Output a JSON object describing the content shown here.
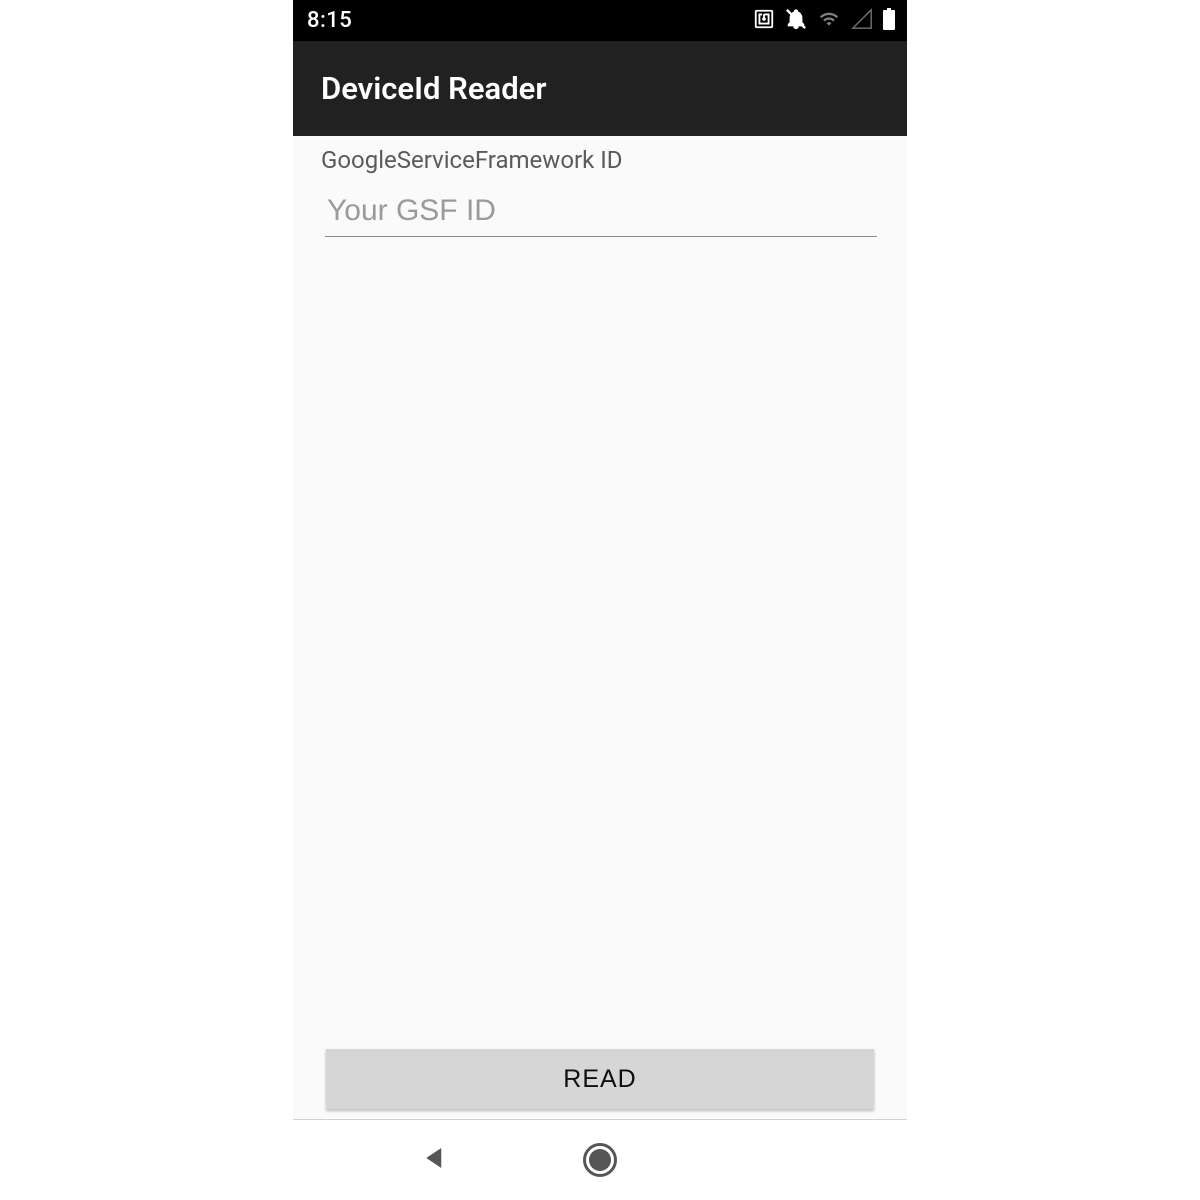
{
  "status_bar": {
    "time": "8:15",
    "icons": {
      "nfc": "nfc-icon",
      "dnd": "dnd-off-icon",
      "wifi": "wifi-icon",
      "signal": "signal-icon",
      "battery": "battery-icon"
    }
  },
  "app_bar": {
    "title": "DeviceId Reader"
  },
  "main": {
    "field_label": "GoogleServiceFramework ID",
    "gsf_input": {
      "value": "",
      "placeholder": "Your GSF ID"
    },
    "read_button_label": "READ"
  },
  "nav_bar": {
    "back": "back-icon",
    "home": "home-icon",
    "recents": "recents-icon"
  }
}
